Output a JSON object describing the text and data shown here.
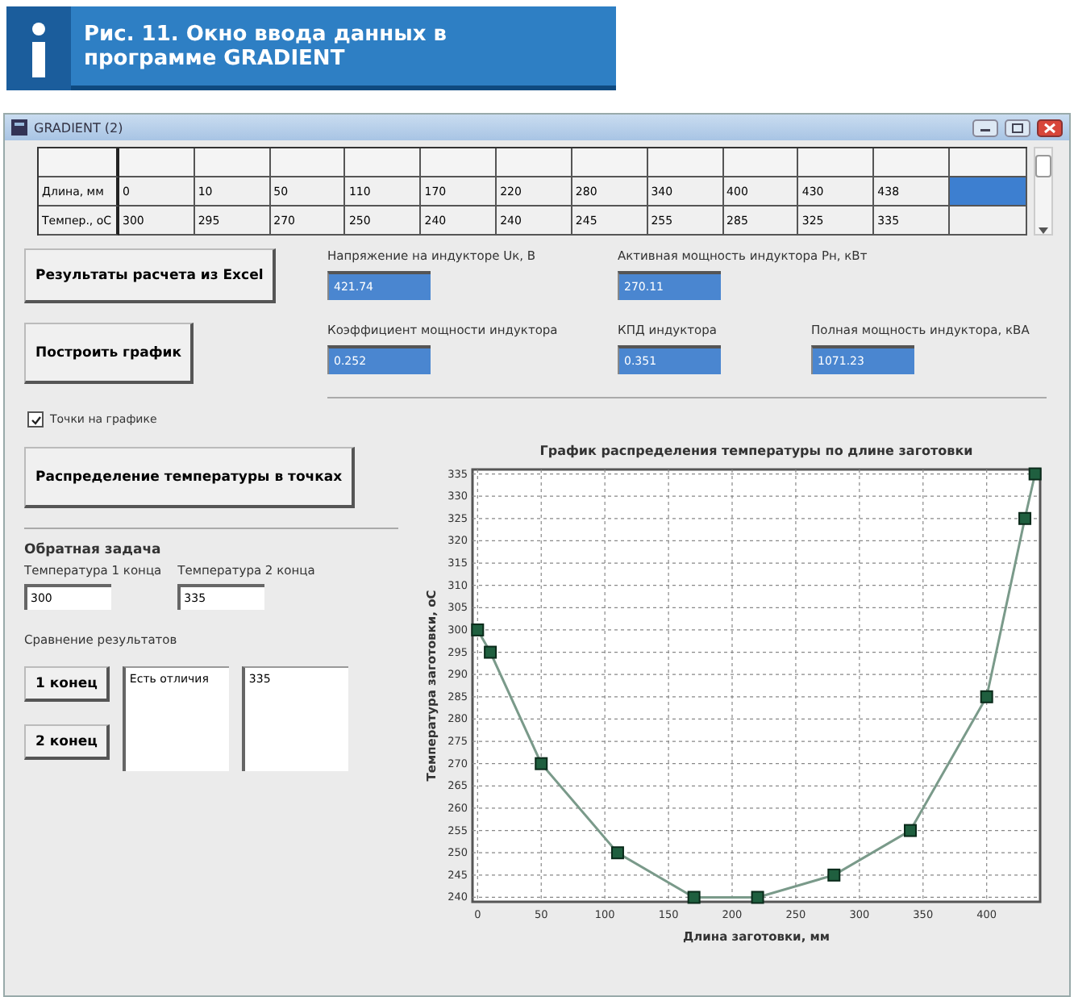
{
  "caption": {
    "text": "Рис. 11. Окно ввода данных в программе GRADIENT"
  },
  "window": {
    "title": "GRADIENT (2)"
  },
  "table": {
    "rows": [
      {
        "label": "Длина, мм",
        "cells": [
          "0",
          "10",
          "50",
          "110",
          "170",
          "220",
          "280",
          "340",
          "400",
          "430",
          "438"
        ],
        "blank_selected": true
      },
      {
        "label": "Темпер., оС",
        "cells": [
          "300",
          "295",
          "270",
          "250",
          "240",
          "240",
          "245",
          "255",
          "285",
          "325",
          "335"
        ],
        "blank_selected": false
      }
    ]
  },
  "top_buttons": [
    "Результаты расчета из Excel",
    "Построить график"
  ],
  "results": [
    {
      "label": "Напряжение на индукторе Uк, В",
      "value": "421.74"
    },
    {
      "label": "Активная мощность индуктора Рн, кВт",
      "value": "270.11"
    },
    {
      "label": "Коэффициент мощности индуктора",
      "value": "0.252"
    },
    {
      "label": "КПД индуктора",
      "value": "0.351"
    },
    {
      "label": "Полная мощность индуктора, кВА",
      "value": "1071.23"
    }
  ],
  "points_checkbox": {
    "label": "Точки на графике",
    "checked": true
  },
  "distribution_button": "Распределение температуры в точках",
  "inverse": {
    "title": "Обратная задача",
    "end1_label": "Температура 1 конца",
    "end1_value": "300",
    "end2_label": "Температура 2 конца",
    "end2_value": "335",
    "compare_title": "Сравнение результатов",
    "buttons": [
      "1 конец",
      "2 конец"
    ],
    "outputs": [
      "Есть отличия",
      "335"
    ]
  },
  "chart_data": {
    "type": "line",
    "title": "График распределения температуры по длине заготовки",
    "xlabel": "Длина заготовки, мм",
    "ylabel": "Температура заготовки, оС",
    "x": [
      0,
      10,
      50,
      110,
      170,
      220,
      280,
      340,
      400,
      430,
      438
    ],
    "grid": true,
    "series": [
      {
        "color": "#1f5f3f",
        "marker": "square",
        "values": [
          300,
          295,
          270,
          250,
          240,
          240,
          245,
          255,
          285,
          325,
          335
        ]
      }
    ],
    "xlim": [
      -4,
      442
    ],
    "ylim": [
      239,
      336
    ],
    "xticks": [
      0,
      50,
      100,
      150,
      200,
      250,
      300,
      350,
      400
    ],
    "yticks": [
      240,
      245,
      250,
      255,
      260,
      265,
      270,
      275,
      280,
      285,
      290,
      295,
      300,
      305,
      310,
      315,
      320,
      325,
      330,
      335
    ]
  }
}
